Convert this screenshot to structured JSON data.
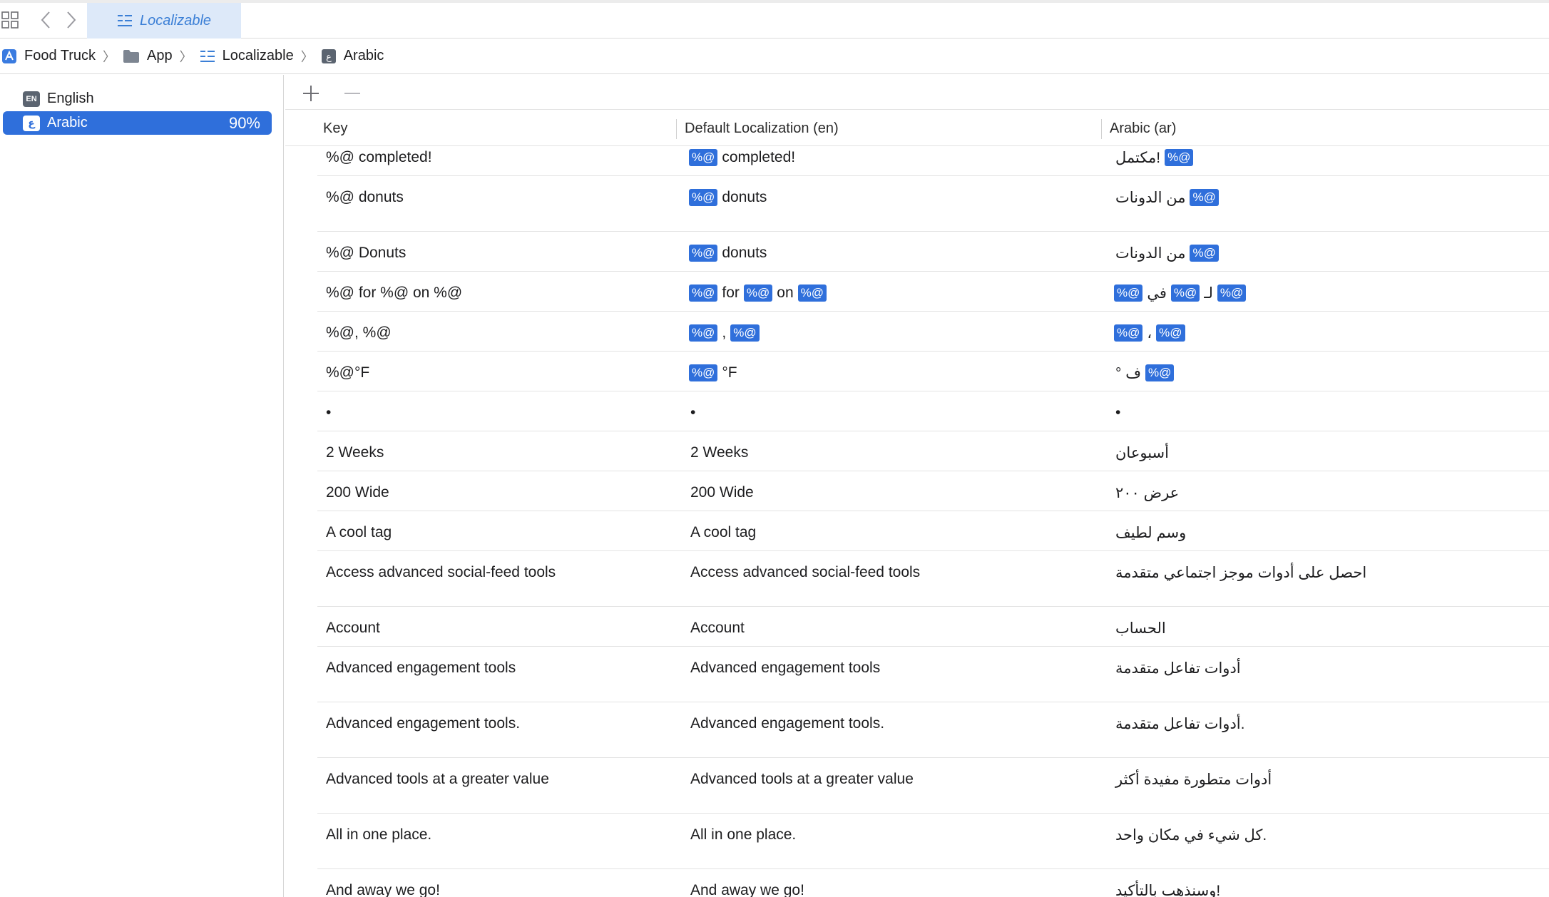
{
  "tabbar": {
    "icons": {
      "grid": "grid-icon",
      "back": "chevron-left-icon",
      "forward": "chevron-right-icon",
      "strings": "string-catalog-icon"
    },
    "active_tab": "Localizable"
  },
  "breadcrumb": [
    {
      "label": "Food Truck",
      "icon": "app-icon"
    },
    {
      "label": "App",
      "icon": "folder-icon"
    },
    {
      "label": "Localizable",
      "icon": "string-catalog-icon"
    },
    {
      "label": "Arabic",
      "icon": "arabic-lang-icon"
    }
  ],
  "sidebar": {
    "languages": [
      {
        "badge": "EN",
        "label": "English",
        "percent": ""
      },
      {
        "badge": "ع",
        "label": "Arabic",
        "percent": "90%"
      }
    ]
  },
  "toolbar": {
    "add_icon": "plus-icon",
    "remove_icon": "minus-icon"
  },
  "table": {
    "columns": [
      "Key",
      "Default Localization (en)",
      "Arabic (ar)"
    ],
    "rows": [
      {
        "key": "%@ completed!",
        "default": [
          [
            "tok",
            "%@"
          ],
          [
            "txt",
            "completed!"
          ]
        ],
        "arabic": [
          [
            "txt",
            "مكتمل!"
          ],
          [
            "tok",
            "%@"
          ]
        ]
      },
      {
        "key": "%@ donuts",
        "default": [
          [
            "tok",
            "%@"
          ],
          [
            "txt",
            "donuts"
          ]
        ],
        "arabic": [
          [
            "txt",
            "من الدونات"
          ],
          [
            "tok",
            "%@"
          ]
        ]
      },
      {
        "key": "%@ Donuts",
        "default": [
          [
            "tok",
            "%@"
          ],
          [
            "txt",
            "donuts"
          ]
        ],
        "arabic": [
          [
            "txt",
            "من الدونات"
          ],
          [
            "tok",
            "%@"
          ]
        ]
      },
      {
        "key": "%@ for %@ on %@",
        "default": [
          [
            "tok",
            "%@"
          ],
          [
            "txt",
            "for"
          ],
          [
            "tok",
            "%@"
          ],
          [
            "txt",
            "on"
          ],
          [
            "tok",
            "%@"
          ]
        ],
        "arabic": [
          [
            "tok",
            "%@"
          ],
          [
            "txt",
            "في"
          ],
          [
            "tok",
            "%@"
          ],
          [
            "txt",
            "لـ"
          ],
          [
            "tok",
            "%@"
          ]
        ]
      },
      {
        "key": "%@, %@",
        "default": [
          [
            "tok",
            "%@"
          ],
          [
            "txt",
            ","
          ],
          [
            "tok",
            "%@"
          ]
        ],
        "arabic": [
          [
            "tok",
            "%@"
          ],
          [
            "txt",
            "،"
          ],
          [
            "tok",
            "%@"
          ]
        ]
      },
      {
        "key": "%@°F",
        "default": [
          [
            "tok",
            "%@"
          ],
          [
            "txt",
            "°F"
          ]
        ],
        "arabic": [
          [
            "txt",
            "° ف"
          ],
          [
            "tok",
            "%@"
          ]
        ]
      },
      {
        "key": "•",
        "default": [
          [
            "txt",
            "•"
          ]
        ],
        "arabic": [
          [
            "txt",
            "•"
          ]
        ]
      },
      {
        "key": "2 Weeks",
        "default": [
          [
            "txt",
            "2 Weeks"
          ]
        ],
        "arabic": [
          [
            "txt",
            "أسبوعان"
          ]
        ]
      },
      {
        "key": "200 Wide",
        "default": [
          [
            "txt",
            "200 Wide"
          ]
        ],
        "arabic": [
          [
            "txt",
            "عرض ٢٠٠"
          ]
        ]
      },
      {
        "key": "A cool tag",
        "default": [
          [
            "txt",
            "A cool tag"
          ]
        ],
        "arabic": [
          [
            "txt",
            "وسم لطيف"
          ]
        ]
      },
      {
        "key": "Access advanced social-feed tools",
        "default": [
          [
            "txt",
            "Access advanced social-feed tools"
          ]
        ],
        "arabic": [
          [
            "txt",
            "احصل على أدوات موجز اجتماعي متقدمة"
          ]
        ]
      },
      {
        "key": "Account",
        "default": [
          [
            "txt",
            "Account"
          ]
        ],
        "arabic": [
          [
            "txt",
            "الحساب"
          ]
        ]
      },
      {
        "key": "Advanced engagement tools",
        "default": [
          [
            "txt",
            "Advanced engagement tools"
          ]
        ],
        "arabic": [
          [
            "txt",
            "أدوات تفاعل متقدمة"
          ]
        ]
      },
      {
        "key": "Advanced engagement tools.",
        "default": [
          [
            "txt",
            "Advanced engagement tools."
          ]
        ],
        "arabic": [
          [
            "txt",
            "أدوات تفاعل متقدمة."
          ]
        ]
      },
      {
        "key": "Advanced tools at a greater value",
        "default": [
          [
            "txt",
            "Advanced tools at a greater value"
          ]
        ],
        "arabic": [
          [
            "txt",
            "أدوات متطورة مفيدة أكثر"
          ]
        ]
      },
      {
        "key": "All in one place.",
        "default": [
          [
            "txt",
            "All in one place."
          ]
        ],
        "arabic": [
          [
            "txt",
            "كل شيء في مكان واحد."
          ]
        ]
      },
      {
        "key": "And away we go!",
        "default": [
          [
            "txt",
            "And away we go!"
          ]
        ],
        "arabic": [
          [
            "txt",
            "وسنذهب بالتأكيد!"
          ]
        ]
      }
    ]
  }
}
